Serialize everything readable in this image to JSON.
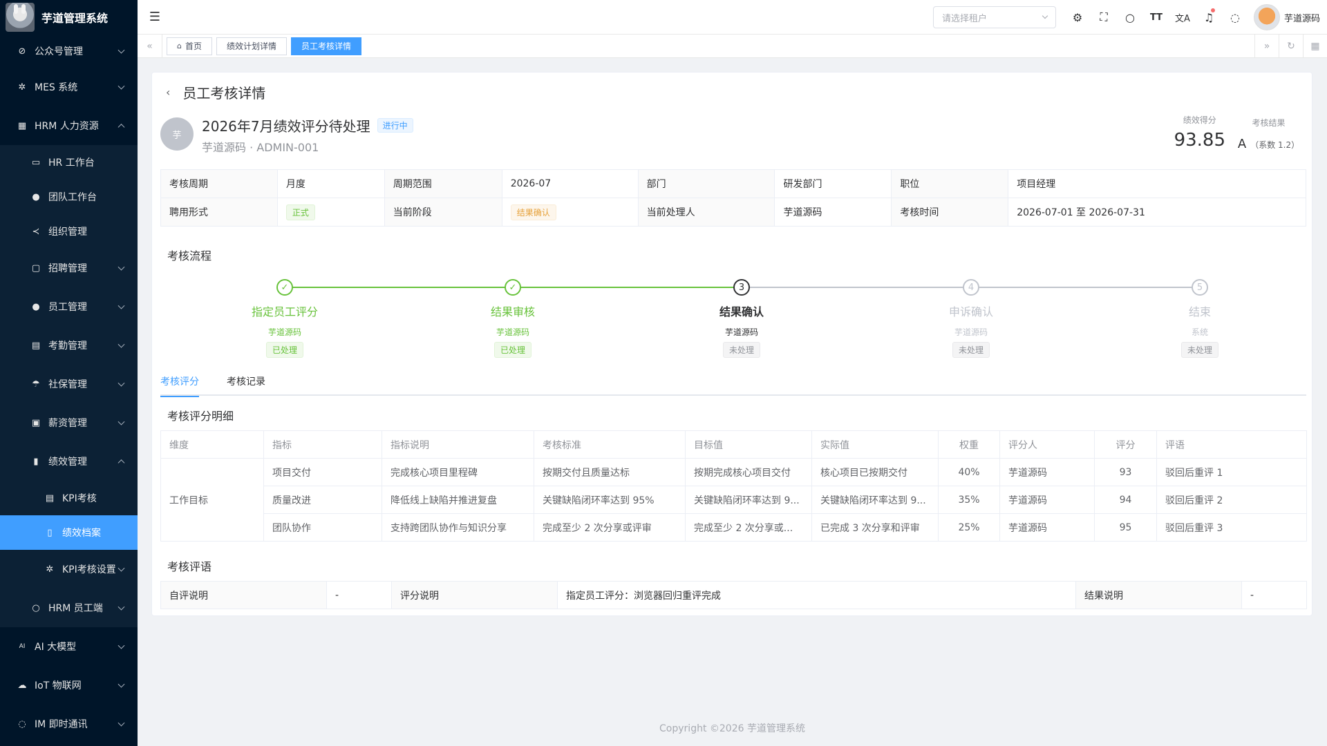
{
  "sidebar": {
    "title": "芋道管理系统",
    "items": [
      {
        "label": "公众号管理",
        "icon": "wechat-icon"
      },
      {
        "label": "MES 系统",
        "icon": "gear-icon"
      },
      {
        "label": "HRM 人力资源",
        "icon": "building-icon"
      },
      {
        "label": "HR 工作台",
        "icon": "monitor-icon"
      },
      {
        "label": "团队工作台",
        "icon": "user-icon"
      },
      {
        "label": "组织管理",
        "icon": "share-icon"
      },
      {
        "label": "招聘管理",
        "icon": "briefcase-icon"
      },
      {
        "label": "员工管理",
        "icon": "user-icon"
      },
      {
        "label": "考勤管理",
        "icon": "calendar-icon"
      },
      {
        "label": "社保管理",
        "icon": "umbrella-icon"
      },
      {
        "label": "薪资管理",
        "icon": "money-icon"
      },
      {
        "label": "绩效管理",
        "icon": "bar-chart-icon"
      },
      {
        "label": "KPI考核",
        "icon": "calendar-icon"
      },
      {
        "label": "绩效档案",
        "icon": "document-icon"
      },
      {
        "label": "KPI考核设置",
        "icon": "settings-icon"
      },
      {
        "label": "HRM 员工端",
        "icon": "person-icon"
      },
      {
        "label": "AI 大模型",
        "icon": "ai-icon"
      },
      {
        "label": "IoT 物联网",
        "icon": "cloud-icon"
      },
      {
        "label": "IM 即时通讯",
        "icon": "chat-icon"
      }
    ]
  },
  "navbar": {
    "tenant_placeholder": "请选择租户",
    "user_name": "芋道源码"
  },
  "tags": [
    "首页",
    "绩效计划详情",
    "员工考核详情"
  ],
  "page": {
    "title": "员工考核详情",
    "avatar_text": "芋",
    "record_title": "2026年7月绩效评分待处理",
    "status_badge": "进行中",
    "subtitle": "芋道源码 · ADMIN-001",
    "score_label": "绩效得分",
    "score_value": "93.85",
    "result_label": "考核结果",
    "result_grade": "A",
    "result_coef": "（系数 1.2）"
  },
  "info": {
    "labels": [
      "考核周期",
      "周期范围",
      "部门",
      "职位",
      "聘用形式",
      "当前阶段",
      "当前处理人",
      "考核时间"
    ],
    "values": [
      "月度",
      "2026-07",
      "研发部门",
      "项目经理",
      "正式",
      "结果确认",
      "芋道源码",
      "2026-07-01 至 2026-07-31"
    ]
  },
  "flow": {
    "title": "考核流程",
    "steps": [
      {
        "index": "1",
        "title": "指定员工评分",
        "person": "芋道源码",
        "status": "已处理",
        "state": "done"
      },
      {
        "index": "2",
        "title": "结果审核",
        "person": "芋道源码",
        "status": "已处理",
        "state": "done"
      },
      {
        "index": "3",
        "title": "结果确认",
        "person": "芋道源码",
        "status": "未处理",
        "state": "current"
      },
      {
        "index": "4",
        "title": "申诉确认",
        "person": "芋道源码",
        "status": "未处理",
        "state": "wait"
      },
      {
        "index": "5",
        "title": "结束",
        "person": "系统",
        "status": "未处理",
        "state": "wait"
      }
    ]
  },
  "tabs": [
    "考核评分",
    "考核记录"
  ],
  "detail": {
    "title": "考核评分明细",
    "headers": [
      "维度",
      "指标",
      "指标说明",
      "考核标准",
      "目标值",
      "实际值",
      "权重",
      "评分人",
      "评分",
      "评语"
    ],
    "dimension": "工作目标",
    "rows": [
      [
        "项目交付",
        "完成核心项目里程碑",
        "按期交付且质量达标",
        "按期完成核心项目交付",
        "核心项目已按期交付",
        "40%",
        "芋道源码",
        "93",
        "驳回后重评 1"
      ],
      [
        "质量改进",
        "降低线上缺陷并推进复盘",
        "关键缺陷闭环率达到 95%",
        "关键缺陷闭环率达到 9...",
        "关键缺陷闭环率达到 9...",
        "35%",
        "芋道源码",
        "94",
        "驳回后重评 2"
      ],
      [
        "团队协作",
        "支持跨团队协作与知识分享",
        "完成至少 2 次分享或评审",
        "完成至少 2 次分享或...",
        "已完成 3 次分享和评审",
        "25%",
        "芋道源码",
        "95",
        "驳回后重评 3"
      ]
    ]
  },
  "comments": {
    "title": "考核评语",
    "self_label": "自评说明",
    "self_value": "-",
    "score_label": "评分说明",
    "score_value": "指定员工评分：浏览器回归重评完成",
    "result_label": "结果说明",
    "result_value": "-"
  },
  "footer": "Copyright ©2026 芋道管理系统"
}
